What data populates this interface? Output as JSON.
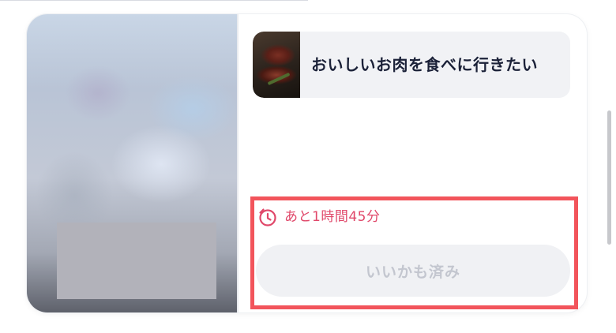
{
  "card": {
    "title": "おいしいお肉を食べに行きたい",
    "time_remaining": "あと1時間45分",
    "like_button_label": "いいかも済み"
  },
  "icons": {
    "thumbnail": "steak-photo",
    "timer": "alarm-clock-icon"
  },
  "colors": {
    "accent_pink": "#e0486a",
    "highlight_red": "#f2545b",
    "title_text": "#1b2138",
    "disabled_button_bg": "#f0f1f4",
    "disabled_button_text": "#c3c6cf"
  }
}
